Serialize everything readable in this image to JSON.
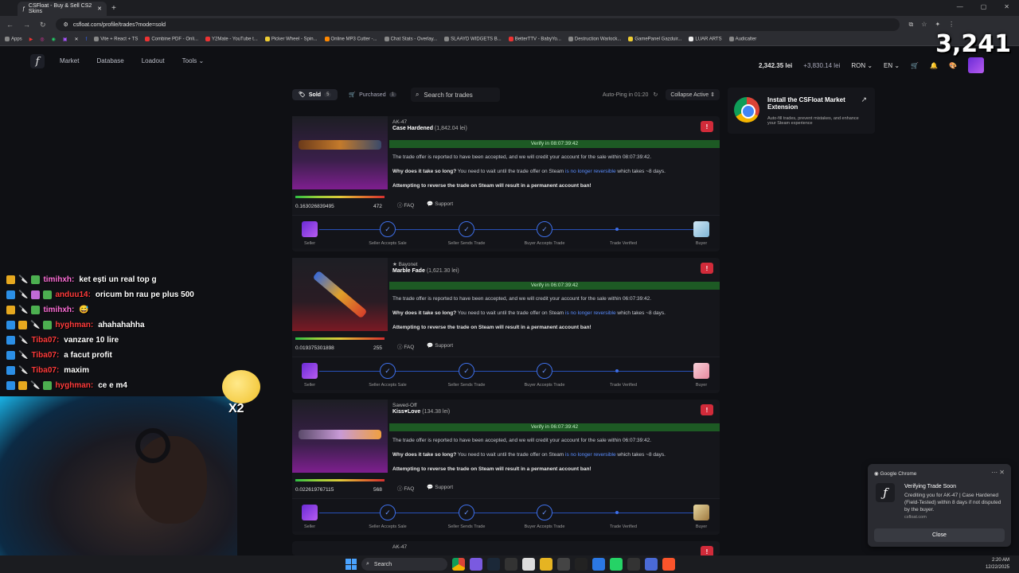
{
  "browser": {
    "tab_title": "CSFloat - Buy & Sell CS2 Skins",
    "url": "csfloat.com/profile/trades?mode=sold",
    "bookmarks": [
      "Apps",
      "Vite + React + TS",
      "Combine PDF - Onli...",
      "Y2Mate - YouTube t...",
      "Picker Wheel - Spin...",
      "Online MP3 Cutter -...",
      "Chat Stats - Overlay...",
      "SLAAYD WIDGETS B...",
      "BetterTTV - BabyYo...",
      "Destruction Warlock...",
      "GamePanel Gazduir...",
      "LUAR ARTS",
      "Audicalter"
    ]
  },
  "overlay": {
    "view_count": "3,241"
  },
  "header": {
    "logo": "f",
    "nav": [
      "Market",
      "Database",
      "Loadout",
      "Tools"
    ],
    "balance": "2,342.35 lei",
    "pending": "+3,830.14 lei",
    "currency": "RON",
    "language": "EN",
    "notifications_count": "1"
  },
  "toolbar": {
    "sold_label": "Sold",
    "sold_count": "5",
    "purchased_label": "Purchased",
    "purchased_count": "1",
    "search_placeholder": "Search for trades",
    "autoping": "Auto-Ping in 01:20",
    "collapse": "Collapse Active"
  },
  "messages": {
    "reported": "The trade offer is reported to have been accepted, and we will credit your account for the sale within ",
    "why_q": "Why does it take so long?",
    "why_text": " You need to wait until the trade offer on Steam ",
    "why_link": "is no longer reversible",
    "why_end": " which takes ~8 days.",
    "warning": "Attempting to reverse the trade on Steam will result in a permanent account ban!",
    "faq": "FAQ",
    "support": "Support"
  },
  "steps": [
    "Seller",
    "Seller Accepts Sale",
    "Seller Sends Trade",
    "Buyer Accepts Trade",
    "Trade Verified",
    "Buyer"
  ],
  "trades": [
    {
      "type": "AK-47",
      "name": "Case Hardened",
      "price": "(1,842.04 lei)",
      "verify": "Verify in 08:07:39:42",
      "countdown": "08:07:39:42",
      "float": "0.163026839495",
      "pattern": "472",
      "float_fraction": 0.16
    },
    {
      "type": "★ Bayonet",
      "name": "Marble Fade",
      "price": "(1,621.30 lei)",
      "verify": "Verify in 06:07:39:42",
      "countdown": "06:07:39:42",
      "float": "0.019375301898",
      "pattern": "255",
      "float_fraction": 0.02
    },
    {
      "type": "Sawed-Off",
      "name": "Kiss♥Love",
      "price": "(134.38 lei)",
      "verify": "Verify in 06:07:39:42",
      "countdown": "06:07:39:42",
      "float": "0.022619767115",
      "pattern": "568",
      "float_fraction": 0.02
    }
  ],
  "next_trade_type": "AK-47",
  "promo": {
    "title": "Install the CSFloat Market Extension",
    "desc": "Auto-fill trades, prevent mistakes, and enhance your Steam experience"
  },
  "chat": [
    {
      "nick": "timihxh:",
      "text": "ket ești un real top g",
      "color": "#ff6fd8"
    },
    {
      "nick": "anduu14:",
      "text": "oricum bn rau pe plus 500",
      "color": "#ff3b3b"
    },
    {
      "nick": "timihxh:",
      "text": "😅",
      "color": "#ff6fd8"
    },
    {
      "nick": "hyghman:",
      "text": "ahahahahha",
      "color": "#ff3b3b"
    },
    {
      "nick": "Tiba07:",
      "text": "vanzare 10 lire",
      "color": "#ff3b3b"
    },
    {
      "nick": "Tiba07:",
      "text": "a facut profit",
      "color": "#ff3b3b"
    },
    {
      "nick": "Tiba07:",
      "text": "maxim",
      "color": "#ff3b3b"
    },
    {
      "nick": "hyghman:",
      "text": "ce e m4",
      "color": "#ff3b3b"
    }
  ],
  "emote_multiplier": "X2",
  "toast": {
    "app": "Google Chrome",
    "title": "Verifying Trade Soon",
    "body": "Crediting you for AK-47 | Case Hardened (Field-Tested) within 8 days if not disputed by the buyer.",
    "site": "csfloat.com",
    "button": "Close"
  },
  "taskbar": {
    "search": "Search",
    "time": "2:20 AM",
    "date": "12/22/2025"
  },
  "colors": {
    "accent_blue": "#3e6fe8",
    "alert_red": "#d12b3a",
    "verify_green": "#1d5a24"
  }
}
